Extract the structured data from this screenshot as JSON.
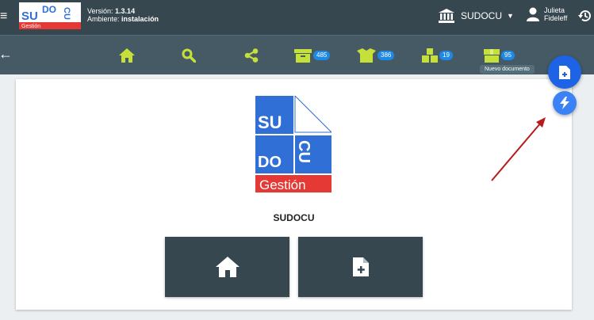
{
  "header": {
    "menu_glyph": "≡",
    "logo": {
      "su": "SU",
      "do": "DO",
      "cu": "CU",
      "brand": "Gestión"
    },
    "version_label": "Versión:",
    "version_value": "1.3.14",
    "environment_label": "Ambiente:",
    "environment_value": "instalación",
    "tenant": "SUDOCU",
    "user_first": "Julieta",
    "user_last": "Fideleff"
  },
  "toolbar": {
    "items": [
      {
        "icon": "home-icon"
      },
      {
        "icon": "search-icon"
      },
      {
        "icon": "share-icon"
      },
      {
        "icon": "archive-icon",
        "count": "485"
      },
      {
        "icon": "open-box-icon",
        "count": "386"
      },
      {
        "icon": "boxes-icon",
        "count": "19"
      },
      {
        "icon": "box-icon",
        "count": "95"
      }
    ]
  },
  "main": {
    "logo": {
      "su": "SU",
      "do": "DO",
      "cu": "CU",
      "brand": "Gestión"
    },
    "title": "SUDOCU",
    "tiles": [
      {
        "icon": "home-icon"
      },
      {
        "icon": "new-document-icon"
      }
    ]
  },
  "fab": {
    "tooltip": "Nuevo documento",
    "main_icon": "new-document-icon",
    "mini_icon": "lightning-icon"
  },
  "colors": {
    "header": "#37474f",
    "toolbar": "#455a64",
    "toolbar_icon": "#c6e03a",
    "badge": "#1e88e5",
    "logo_blue": "#2f6fd6",
    "logo_red": "#e53935",
    "fab": "#1e63e6",
    "annotation_arrow": "#b71c1c"
  }
}
